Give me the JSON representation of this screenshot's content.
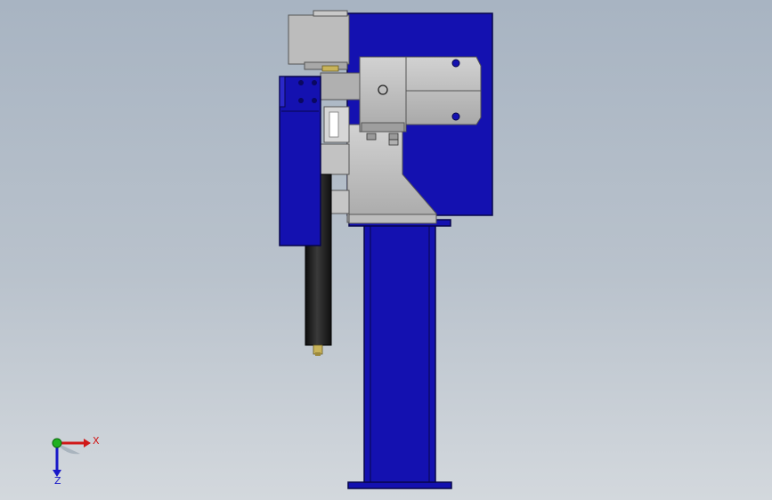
{
  "viewport": {
    "background_top": "#a8b4c2",
    "background_bottom": "#d3d8dd"
  },
  "model": {
    "name": "machine-assembly-front-view",
    "colors": {
      "blue": "#1411b0",
      "dark_blue_edge": "#0a0860",
      "grey": "#b4b4b4",
      "dark_grey": "#8a8a8a",
      "black_cylinder": "#1e1e1e",
      "brass": "#c8b35a"
    }
  },
  "triad": {
    "x_label": "X",
    "z_label": "Z",
    "x_color": "#d01818",
    "y_color": "#20b020",
    "z_color": "#1818c8"
  }
}
